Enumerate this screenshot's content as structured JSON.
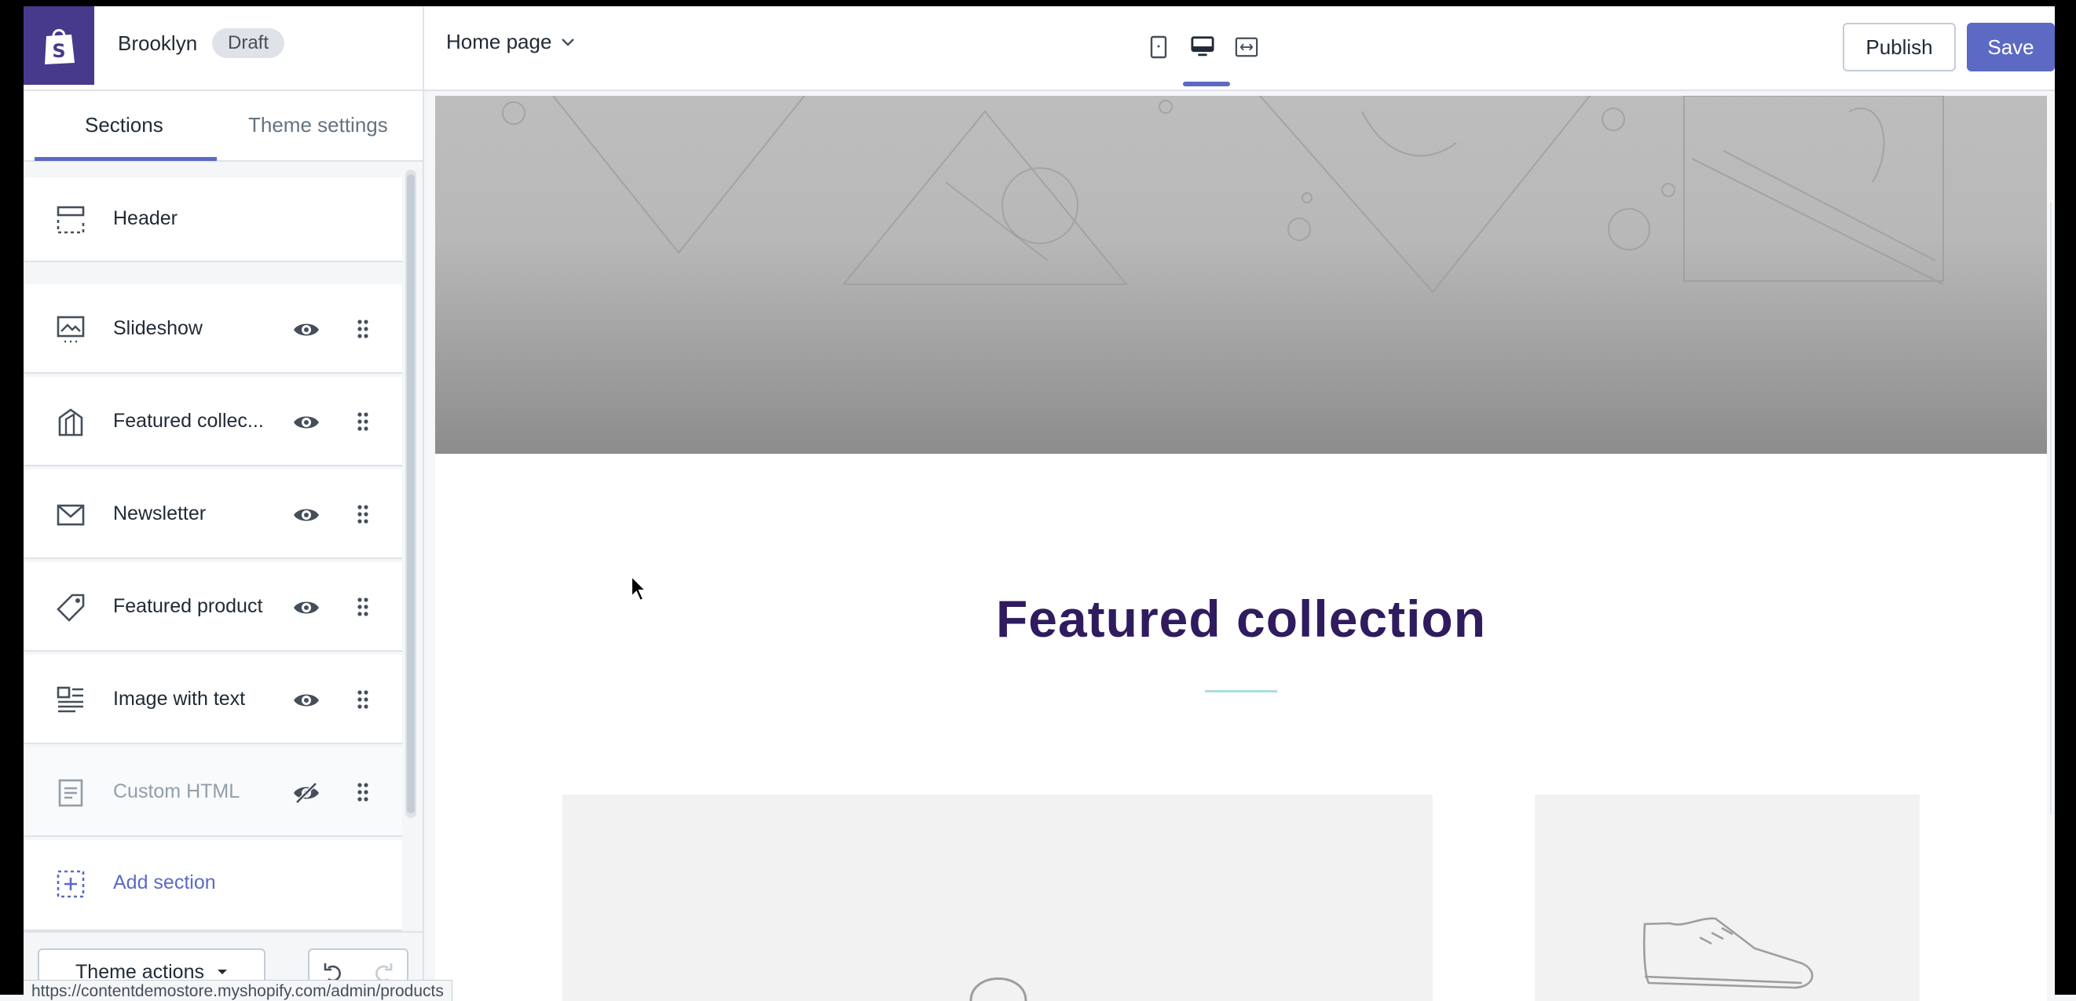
{
  "store": {
    "name": "Brooklyn",
    "status": "Draft"
  },
  "toolbar": {
    "page_select": "Home page",
    "views": [
      "mobile-view-icon",
      "desktop-view-icon",
      "fullscreen-view-icon"
    ],
    "active_view": "desktop",
    "publish_label": "Publish",
    "save_label": "Save"
  },
  "sidebar": {
    "tabs": [
      {
        "label": "Sections",
        "active": true
      },
      {
        "label": "Theme settings",
        "active": false
      }
    ],
    "header_item": {
      "label": "Header",
      "icon": "header-layout-icon"
    },
    "sections": [
      {
        "label": "Slideshow",
        "icon": "slideshow-icon",
        "visible": true
      },
      {
        "label": "Featured collec...",
        "icon": "collection-icon",
        "visible": true
      },
      {
        "label": "Newsletter",
        "icon": "envelope-icon",
        "visible": true
      },
      {
        "label": "Featured product",
        "icon": "tag-icon",
        "visible": true
      },
      {
        "label": "Image with text",
        "icon": "image-text-icon",
        "visible": true
      },
      {
        "label": "Custom HTML",
        "icon": "document-icon",
        "visible": false
      }
    ],
    "add_section_label": "Add section",
    "theme_actions_label": "Theme actions"
  },
  "preview": {
    "featured_title": "Featured collection"
  },
  "status_url": "https://contentdemostore.myshopify.com/admin/products",
  "colors": {
    "accent": "#5c6ac4",
    "logo_bg": "#47398c",
    "title": "#2f1b5e"
  }
}
